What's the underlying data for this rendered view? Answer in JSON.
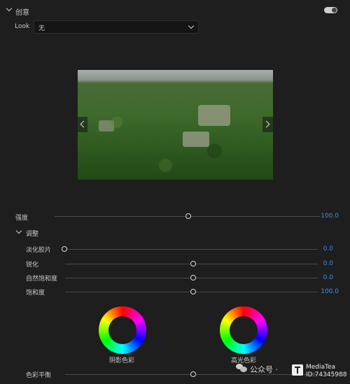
{
  "section": {
    "title": "创意",
    "toggle_on": true
  },
  "look": {
    "label": "Look",
    "value": "无"
  },
  "intensity": {
    "label": "强度",
    "value_text": "100.0",
    "fraction": 0.5
  },
  "adjust": {
    "title": "调整"
  },
  "sliders": [
    {
      "label": "淡化胶片",
      "value_text": "0.0",
      "fraction": 0.0
    },
    {
      "label": "锐化",
      "value_text": "0.0",
      "fraction": 0.5
    },
    {
      "label": "自然饱和度",
      "value_text": "0.0",
      "fraction": 0.5
    },
    {
      "label": "饱和度",
      "value_text": "100.0",
      "fraction": 0.5
    }
  ],
  "wheels": {
    "shadow_label": "阴影色彩",
    "highlight_label": "高光色彩"
  },
  "balance": {
    "label": "色彩平衡",
    "fraction": 0.5
  },
  "watermark": {
    "text": "公众号 ·",
    "brand": "MediaTea",
    "id_text": "ID:74345988"
  },
  "colors": {
    "accent": "#3d8eea",
    "panel": "#1e1e1e"
  }
}
